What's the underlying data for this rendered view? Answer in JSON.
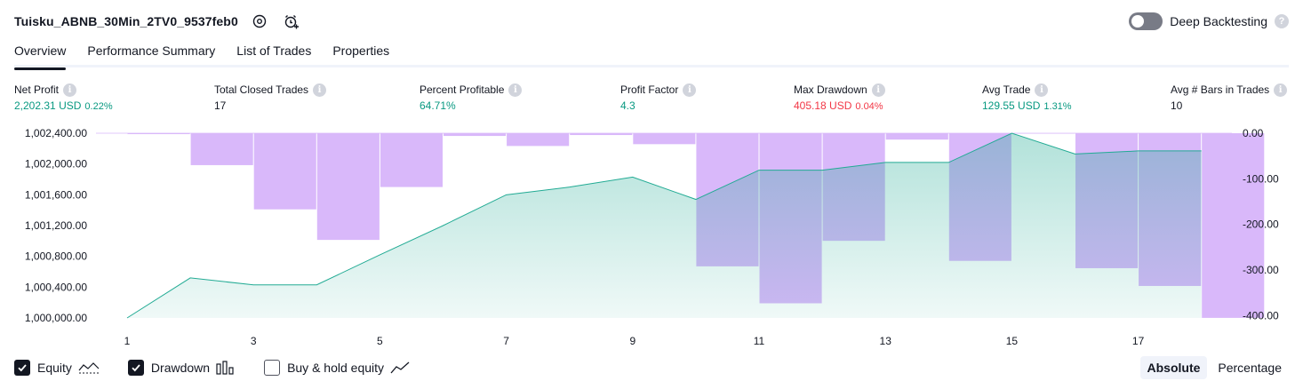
{
  "header": {
    "title": "Tuisku_ABNB_30Min_2TV0_9537feb0",
    "deep_backtesting_label": "Deep Backtesting",
    "help_glyph": "?"
  },
  "tabs": [
    {
      "label": "Overview",
      "active": true
    },
    {
      "label": "Performance Summary",
      "active": false
    },
    {
      "label": "List of Trades",
      "active": false
    },
    {
      "label": "Properties",
      "active": false
    }
  ],
  "stats": [
    {
      "label": "Net Profit",
      "value": "2,202.31",
      "unit": "USD",
      "pct": "0.22%",
      "color": "green"
    },
    {
      "label": "Total Closed Trades",
      "value": "17",
      "unit": "",
      "pct": "",
      "color": "dark"
    },
    {
      "label": "Percent Profitable",
      "value": "64.71%",
      "unit": "",
      "pct": "",
      "color": "green"
    },
    {
      "label": "Profit Factor",
      "value": "4.3",
      "unit": "",
      "pct": "",
      "color": "green"
    },
    {
      "label": "Max Drawdown",
      "value": "405.18",
      "unit": "USD",
      "pct": "0.04%",
      "color": "red"
    },
    {
      "label": "Avg Trade",
      "value": "129.55",
      "unit": "USD",
      "pct": "1.31%",
      "color": "green"
    },
    {
      "label": "Avg # Bars in Trades",
      "value": "10",
      "unit": "",
      "pct": "",
      "color": "dark"
    }
  ],
  "info_glyph": "i",
  "chart_data": {
    "type": "area",
    "x_ticks": [
      "1",
      "3",
      "5",
      "7",
      "9",
      "11",
      "13",
      "15",
      "17"
    ],
    "y_left_ticks": [
      "1,002,400.00",
      "1,002,000.00",
      "1,001,600.00",
      "1,001,200.00",
      "1,000,800.00",
      "1,000,400.00",
      "1,000,000.00"
    ],
    "y_right_ticks": [
      "0.00",
      "-100.00",
      "-200.00",
      "-300.00",
      "-400.00"
    ],
    "y_left_range": [
      1000000,
      1002400
    ],
    "y_right_range": [
      -405.18,
      0
    ],
    "equity": {
      "x": [
        1,
        2,
        3,
        4,
        5,
        6,
        7,
        8,
        9,
        10,
        11,
        12,
        13,
        14,
        15,
        16,
        17,
        18
      ],
      "values": [
        1000000,
        1000520,
        1000430,
        1000430,
        1000820,
        1001200,
        1001600,
        1001700,
        1001830,
        1001540,
        1001920,
        1001920,
        1002020,
        1002020,
        1002400,
        1002130,
        1002170,
        1002170
      ],
      "line_color": "#22ab94",
      "fill_color": "#22ab94"
    },
    "drawdown": {
      "x": [
        1,
        2,
        3,
        4,
        5,
        6,
        7,
        8,
        9,
        10,
        11,
        12,
        13,
        14,
        15,
        16,
        17,
        18
      ],
      "values": [
        -2,
        -70,
        -167,
        -234,
        -118,
        -6,
        -28,
        -4,
        -24,
        -292,
        -373,
        -236,
        -14,
        -280,
        0,
        -296,
        -335,
        -405
      ],
      "color": "#d9b8fa"
    }
  },
  "legend": [
    {
      "label": "Equity",
      "checked": true,
      "icon": "equity-line-icon"
    },
    {
      "label": "Drawdown",
      "checked": true,
      "icon": "drawdown-bars-icon"
    },
    {
      "label": "Buy & hold equity",
      "checked": false,
      "icon": "buy-hold-line-icon"
    }
  ],
  "modes": [
    {
      "label": "Absolute",
      "active": true
    },
    {
      "label": "Percentage",
      "active": false
    }
  ]
}
